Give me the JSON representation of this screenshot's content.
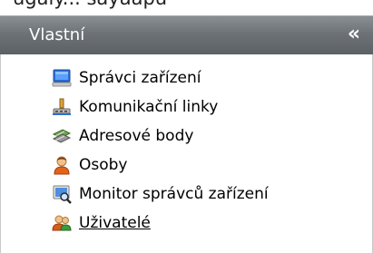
{
  "top_text": "ugaly... sayaapu",
  "panel": {
    "title": "Vlastní",
    "collapse_label": "«"
  },
  "items": [
    {
      "label": "Správci zařízení",
      "icon": "monitor-icon"
    },
    {
      "label": "Komunikační linky",
      "icon": "network-link-icon"
    },
    {
      "label": "Adresové body",
      "icon": "address-points-icon"
    },
    {
      "label": "Osoby",
      "icon": "person-icon"
    },
    {
      "label": "Monitor správců zařízení",
      "icon": "monitor-search-icon"
    },
    {
      "label": "Uživatelé",
      "icon": "users-icon"
    }
  ],
  "colors": {
    "header_bg": "#6d7276",
    "header_text": "#ffffff"
  }
}
